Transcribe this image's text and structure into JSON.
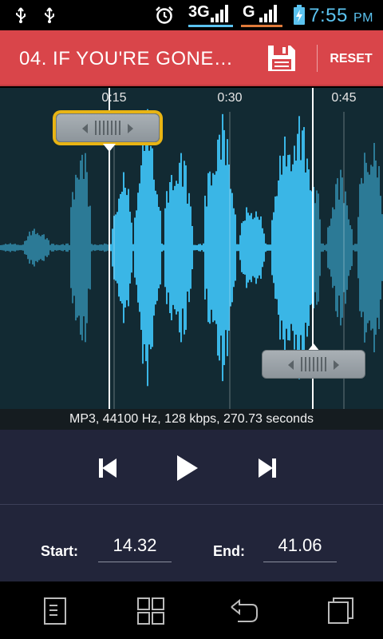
{
  "status_bar": {
    "network_1": "3G",
    "network_2": "G",
    "time": "7:55",
    "ampm": "PM",
    "icons": [
      "usb-icon",
      "usb-icon",
      "alarm-icon",
      "signal-icon",
      "signal-icon",
      "battery-charging-icon"
    ]
  },
  "header": {
    "title": "04. IF YOU'RE GONE…",
    "save_icon": "save-icon",
    "reset_label": "RESET"
  },
  "waveform": {
    "ticks": [
      "0:15",
      "0:30",
      "0:45"
    ],
    "start_handle_icon": "drag-handle-icon",
    "end_handle_icon": "drag-handle-icon"
  },
  "file_info": "MP3, 44100 Hz, 128 kbps, 270.73 seconds",
  "controls": {
    "prev_icon": "skip-previous-icon",
    "play_icon": "play-icon",
    "next_icon": "skip-next-icon"
  },
  "range": {
    "start_label": "Start:",
    "start_value": "14.32",
    "end_label": "End:",
    "end_value": "41.06"
  },
  "nav": [
    "menu-icon",
    "apps-icon",
    "back-icon",
    "recent-apps-icon"
  ],
  "colors": {
    "header": "#d9454a",
    "accent": "#5bc3f0",
    "selection": "#3ab6e6",
    "unselected_wave": "#2c7a96",
    "start_highlight": "#e8b414",
    "panel": "#22253a"
  }
}
